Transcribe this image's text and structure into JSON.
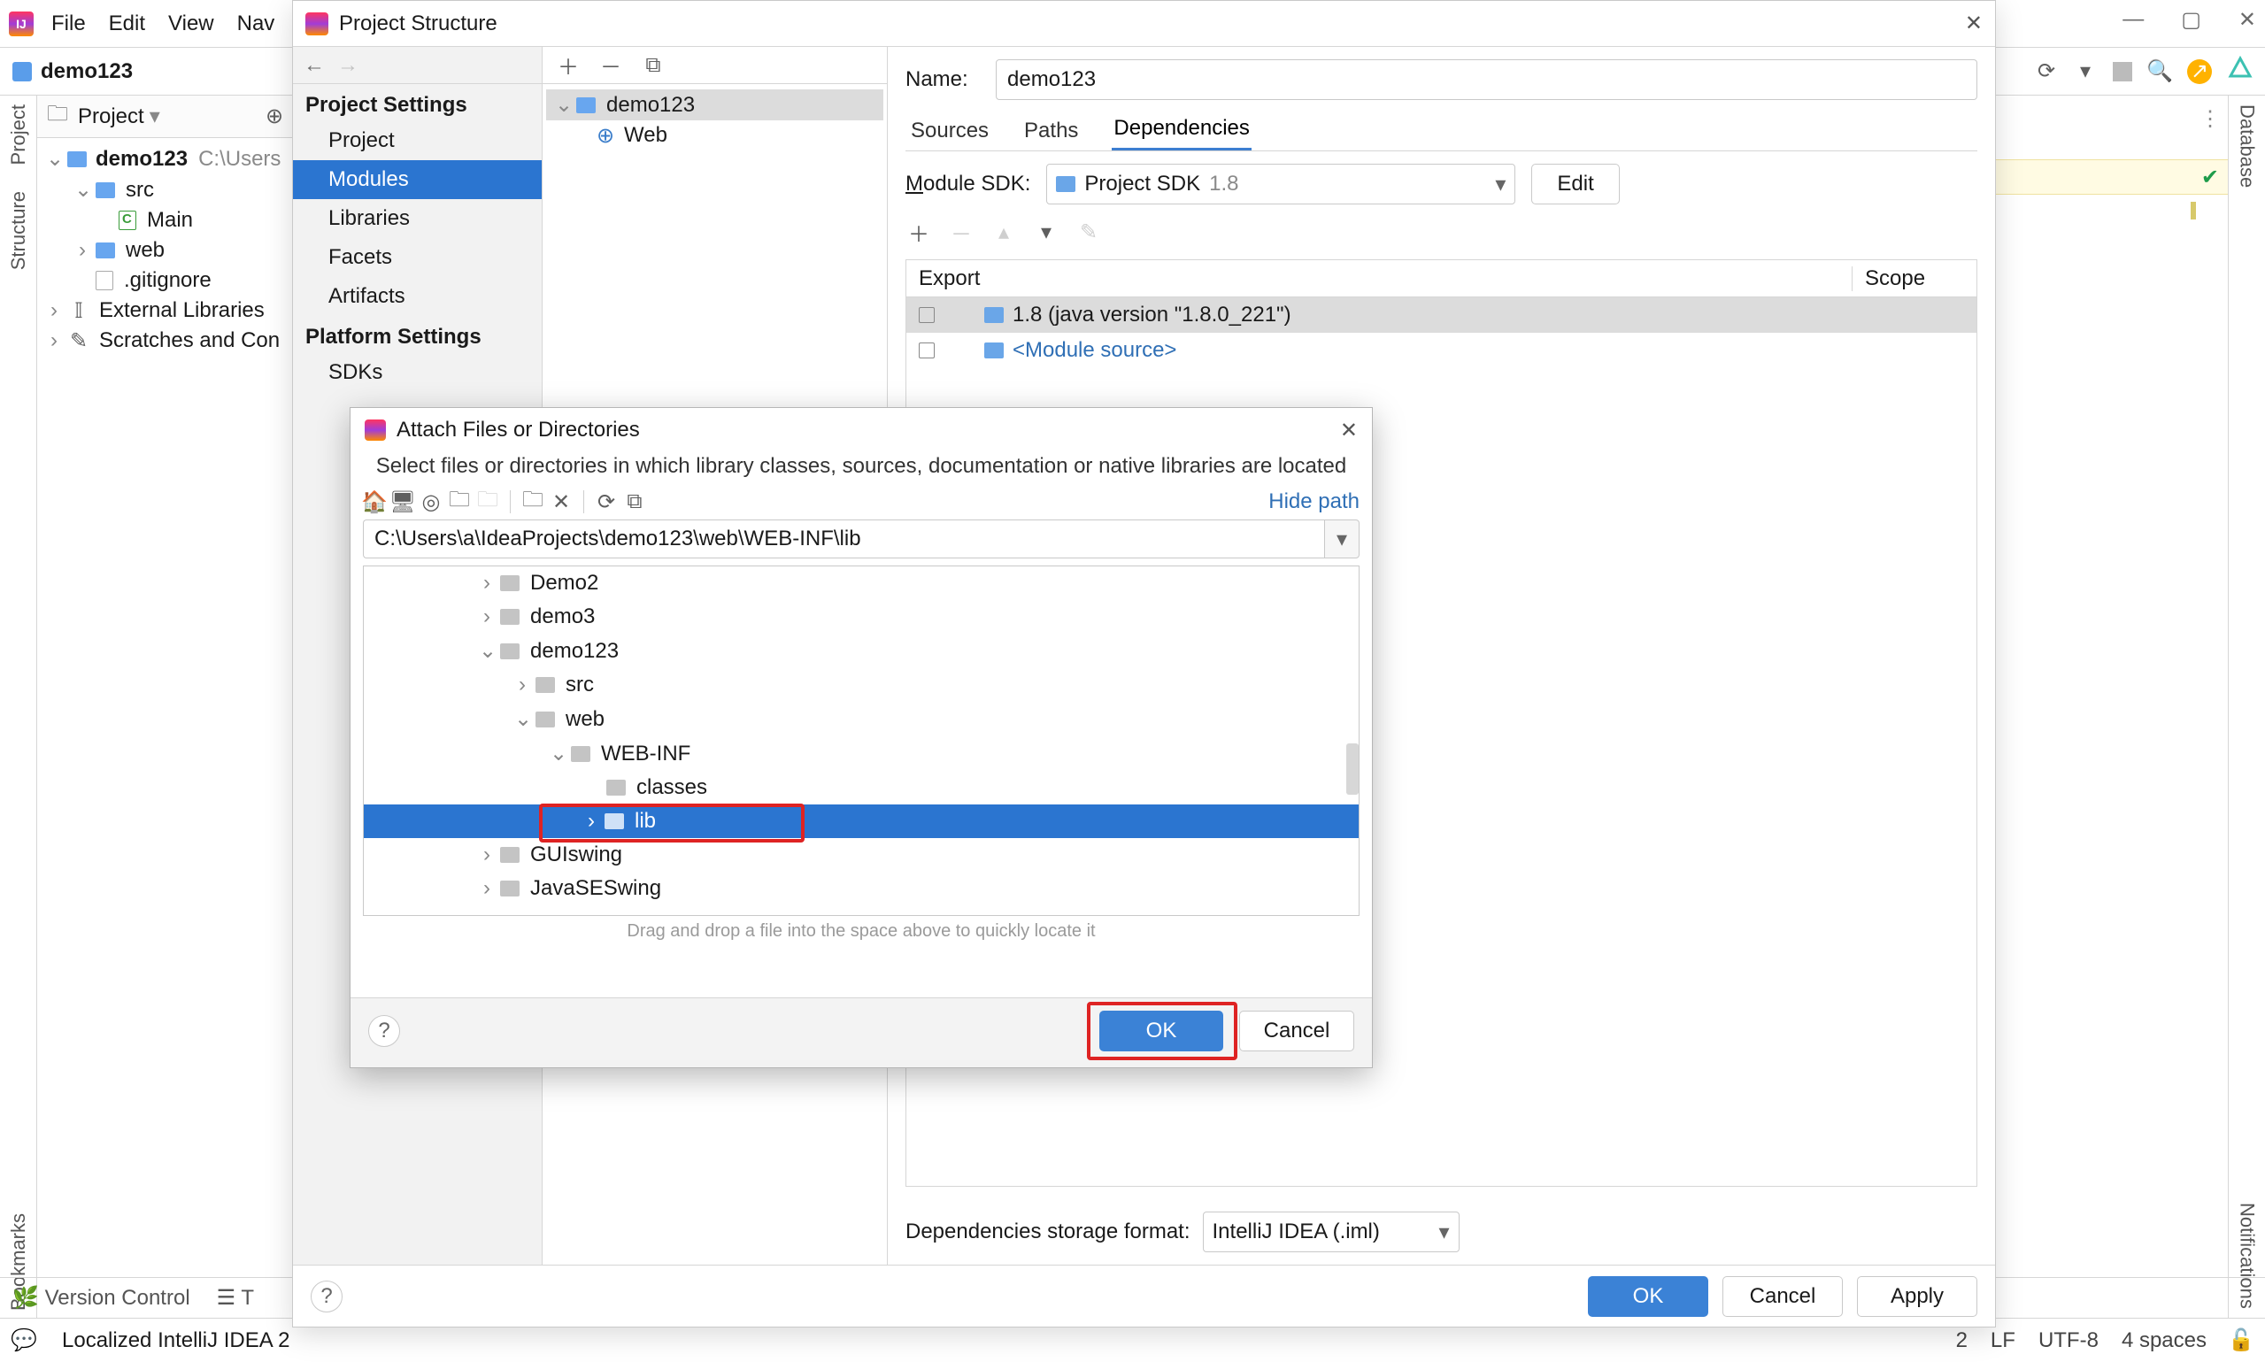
{
  "main_window": {
    "menu": [
      "File",
      "Edit",
      "View",
      "Nav"
    ],
    "breadcrumb": "demo123",
    "window_buttons": [
      "minimize",
      "maximize",
      "close"
    ]
  },
  "right_rail": {
    "top_label": "Database",
    "bottom_label": "Notifications"
  },
  "left_rail": {
    "top_label": "Project",
    "mid_label": "Structure",
    "bottom_label": "Bookmarks"
  },
  "project_tool_window": {
    "title": "Project",
    "tree": {
      "root": {
        "name": "demo123",
        "suffix": "C:\\Users"
      },
      "items": [
        {
          "indent": 1,
          "chev": "v",
          "icon": "folder-blue",
          "label": "src"
        },
        {
          "indent": 2,
          "chev": "",
          "icon": "file-c",
          "label": "Main"
        },
        {
          "indent": 1,
          "chev": ">",
          "icon": "folder-blue",
          "label": "web"
        },
        {
          "indent": 1,
          "chev": "",
          "icon": "file-gitignore",
          "label": ".gitignore"
        },
        {
          "indent": 0,
          "chev": ">",
          "icon": "libraries",
          "label": "External Libraries"
        },
        {
          "indent": 0,
          "chev": ">",
          "icon": "scratches",
          "label": "Scratches and Con"
        }
      ]
    }
  },
  "project_structure": {
    "title": "Project Structure",
    "nav": {
      "sections": [
        {
          "title": "Project Settings",
          "items": [
            "Project",
            "Modules",
            "Libraries",
            "Facets",
            "Artifacts"
          ],
          "active": "Modules"
        },
        {
          "title": "Platform Settings",
          "items": [
            "SDKs"
          ]
        }
      ]
    },
    "modules_panel": {
      "toolbar_icons": [
        "plus",
        "minus",
        "copy"
      ],
      "tree": [
        {
          "indent": 0,
          "chev": "v",
          "icon": "module",
          "label": "demo123"
        },
        {
          "indent": 1,
          "chev": "",
          "icon": "web-facet",
          "label": "Web"
        }
      ]
    },
    "main": {
      "name_label": "Name:",
      "name_value": "demo123",
      "tabs": [
        "Sources",
        "Paths",
        "Dependencies"
      ],
      "active_tab": "Dependencies",
      "sdk_label_html": "Module SDK:",
      "sdk_combo": {
        "text": "Project SDK",
        "suffix": "1.8"
      },
      "edit_btn": "Edit",
      "deps_tools": [
        "plus",
        "minus",
        "up",
        "down",
        "edit"
      ],
      "deps_header": {
        "c1": "Export",
        "c2": "Scope"
      },
      "deps_rows": [
        {
          "selected": true,
          "icon": "sdk",
          "text": "1.8 (java version \"1.8.0_221\")"
        },
        {
          "selected": false,
          "icon": "module-src",
          "text": "<Module source>",
          "link": true
        }
      ],
      "storage_label": "Dependencies storage format:",
      "storage_value": "IntelliJ IDEA (.iml)"
    },
    "footer": {
      "ok": "OK",
      "cancel": "Cancel",
      "apply": "Apply"
    }
  },
  "attach_dialog": {
    "title": "Attach Files or Directories",
    "description": "Select files or directories in which library classes, sources, documentation or native libraries are located",
    "toolbar": {
      "icons": [
        "home",
        "desktop",
        "project-root",
        "new-folder",
        "new-folder-disabled",
        "sep",
        "copy-folder",
        "delete",
        "sep",
        "refresh",
        "show-hidden"
      ],
      "hide_path": "Hide path"
    },
    "path_value": "C:\\Users\\a\\IdeaProjects\\demo123\\web\\WEB-INF\\lib",
    "tree": [
      {
        "indent": 3,
        "chev": ">",
        "label": "Demo2"
      },
      {
        "indent": 3,
        "chev": ">",
        "label": "demo3"
      },
      {
        "indent": 3,
        "chev": "v",
        "label": "demo123"
      },
      {
        "indent": 4,
        "chev": ">",
        "label": "src"
      },
      {
        "indent": 4,
        "chev": "v",
        "label": "web"
      },
      {
        "indent": 5,
        "chev": "v",
        "label": "WEB-INF"
      },
      {
        "indent": 6,
        "chev": "",
        "label": "classes"
      },
      {
        "indent": 6,
        "chev": ">",
        "label": "lib",
        "selected": true
      },
      {
        "indent": 3,
        "chev": ">",
        "label": "GUIswing"
      },
      {
        "indent": 3,
        "chev": ">",
        "label": "JavaSESwing"
      }
    ],
    "drop_hint": "Drag and drop a file into the space above to quickly locate it",
    "footer": {
      "ok": "OK",
      "cancel": "Cancel"
    }
  },
  "statusbar": {
    "version_control": "Version Control",
    "todo": "T",
    "message": "Localized IntelliJ IDEA 2",
    "right": [
      "2",
      "LF",
      "UTF-8",
      "4 spaces"
    ]
  }
}
